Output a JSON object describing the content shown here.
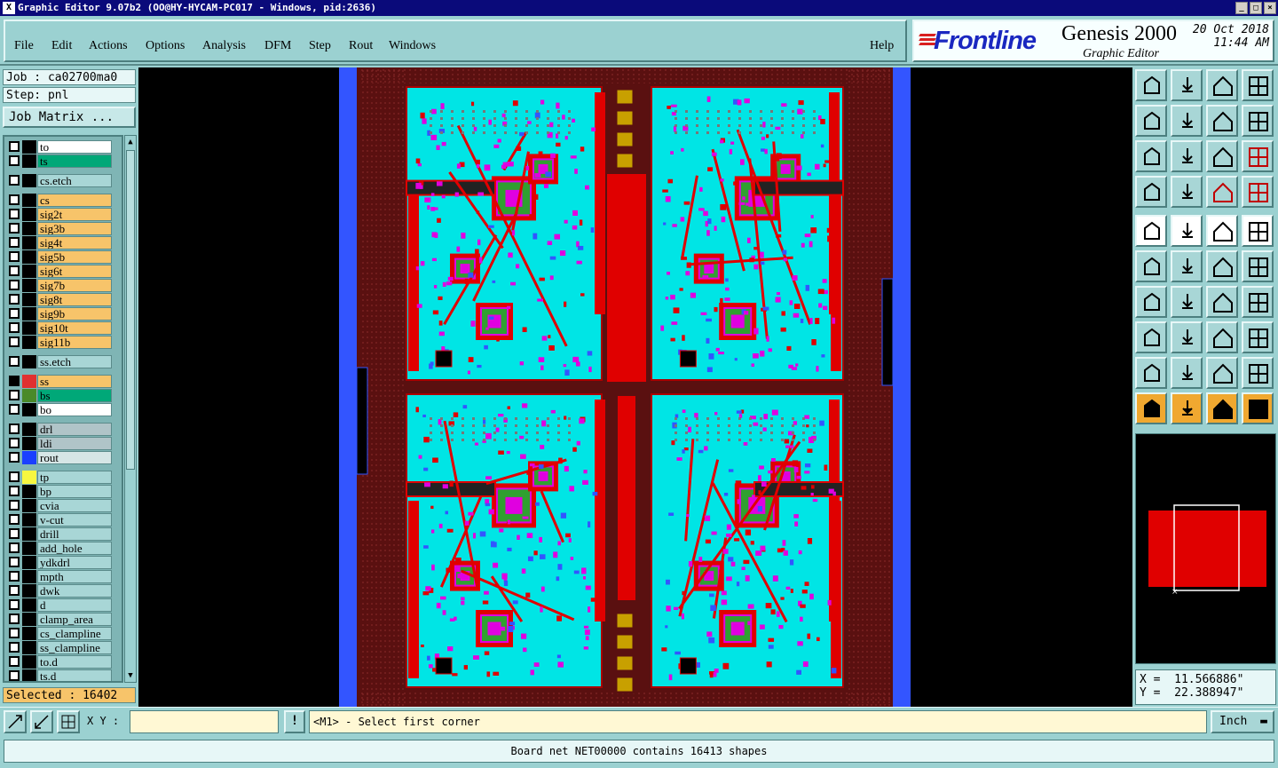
{
  "window": {
    "title": "Graphic Editor 9.07b2 (OO@HY-HYCAM-PC017 - Windows, pid:2636)",
    "sys_icon": "X",
    "btn_min": "_",
    "btn_max": "□",
    "btn_close": "×"
  },
  "menu": {
    "file": "File",
    "edit": "Edit",
    "actions": "Actions",
    "options": "Options",
    "analysis": "Analysis",
    "dfm": "DFM",
    "step": "Step",
    "rout": "Rout",
    "windows": "Windows",
    "help": "Help"
  },
  "logo": {
    "brand": "Frontline",
    "product": "Genesis 2000",
    "subtitle": "Graphic Editor",
    "date": "20 Oct 2018",
    "time": "11:44 AM"
  },
  "job": {
    "job_label": "Job : ca02700ma0",
    "step_label": "Step: pnl",
    "matrix_button": "Job Matrix ..."
  },
  "layers": [
    {
      "name": "to",
      "color": "#ffffff",
      "sw": "#000000"
    },
    {
      "name": "ts",
      "color": "#00a878",
      "sw": "#000000"
    },
    {
      "name": "cs.etch",
      "color": "#a8d6d6",
      "sw": "#000000"
    },
    {
      "name": "cs",
      "color": "#f7c46a",
      "sw": "#000000"
    },
    {
      "name": "sig2t",
      "color": "#f7c46a",
      "sw": "#000000"
    },
    {
      "name": "sig3b",
      "color": "#f7c46a",
      "sw": "#000000"
    },
    {
      "name": "sig4t",
      "color": "#f7c46a",
      "sw": "#000000"
    },
    {
      "name": "sig5b",
      "color": "#f7c46a",
      "sw": "#000000"
    },
    {
      "name": "sig6t",
      "color": "#f7c46a",
      "sw": "#000000"
    },
    {
      "name": "sig7b",
      "color": "#f7c46a",
      "sw": "#000000"
    },
    {
      "name": "sig8t",
      "color": "#f7c46a",
      "sw": "#000000"
    },
    {
      "name": "sig9b",
      "color": "#f7c46a",
      "sw": "#000000"
    },
    {
      "name": "sig10t",
      "color": "#f7c46a",
      "sw": "#000000"
    },
    {
      "name": "sig11b",
      "color": "#f7c46a",
      "sw": "#000000"
    },
    {
      "name": "ss.etch",
      "color": "#a8d6d6",
      "sw": "#000000"
    },
    {
      "name": "ss",
      "color": "#f7c46a",
      "sw": "#e03030",
      "on": true
    },
    {
      "name": "bs",
      "color": "#00a878",
      "sw": "#4a8a2a"
    },
    {
      "name": "bo",
      "color": "#ffffff",
      "sw": "#000000"
    },
    {
      "name": "drl",
      "color": "#b0c4c8",
      "sw": "#000000"
    },
    {
      "name": "ldi",
      "color": "#b0c4c8",
      "sw": "#000000"
    },
    {
      "name": "rout",
      "color": "#d6e6e6",
      "sw": "#1a40ff"
    },
    {
      "name": "tp",
      "color": "#a8d6d6",
      "sw": "#f7f740"
    },
    {
      "name": "bp",
      "color": "#a8d6d6",
      "sw": "#000000"
    },
    {
      "name": "cvia",
      "color": "#a8d6d6",
      "sw": "#000000"
    },
    {
      "name": "v-cut",
      "color": "#a8d6d6",
      "sw": "#000000"
    },
    {
      "name": "drill",
      "color": "#a8d6d6",
      "sw": "#000000"
    },
    {
      "name": "add_hole",
      "color": "#a8d6d6",
      "sw": "#000000"
    },
    {
      "name": "ydkdrl",
      "color": "#a8d6d6",
      "sw": "#000000"
    },
    {
      "name": "mpth",
      "color": "#a8d6d6",
      "sw": "#000000"
    },
    {
      "name": "dwk",
      "color": "#a8d6d6",
      "sw": "#000000"
    },
    {
      "name": "d",
      "color": "#a8d6d6",
      "sw": "#000000"
    },
    {
      "name": "clamp_area",
      "color": "#a8d6d6",
      "sw": "#000000"
    },
    {
      "name": "cs_clampline",
      "color": "#a8d6d6",
      "sw": "#000000"
    },
    {
      "name": "ss_clampline",
      "color": "#a8d6d6",
      "sw": "#000000"
    },
    {
      "name": "to.d",
      "color": "#a8d6d6",
      "sw": "#000000"
    },
    {
      "name": "ts.d",
      "color": "#a8d6d6",
      "sw": "#000000"
    }
  ],
  "selected": "Selected : 16402",
  "coords": {
    "x": "X =  11.566886\"",
    "y": "Y =  22.388947\""
  },
  "bottom": {
    "xy_label": "X Y :",
    "xy_value": "",
    "bang": "!",
    "prompt": "<M1> - Select first corner",
    "units": "Inch"
  },
  "status": "Board net NET00000 contains 16413 shapes",
  "colors": {
    "board_cyan": "#00e5e5",
    "copper_red": "#e00000",
    "frame_dark": "#5a1010",
    "rout_blue": "#3355ff",
    "magenta": "#e000e0",
    "component_green": "#30a030"
  }
}
